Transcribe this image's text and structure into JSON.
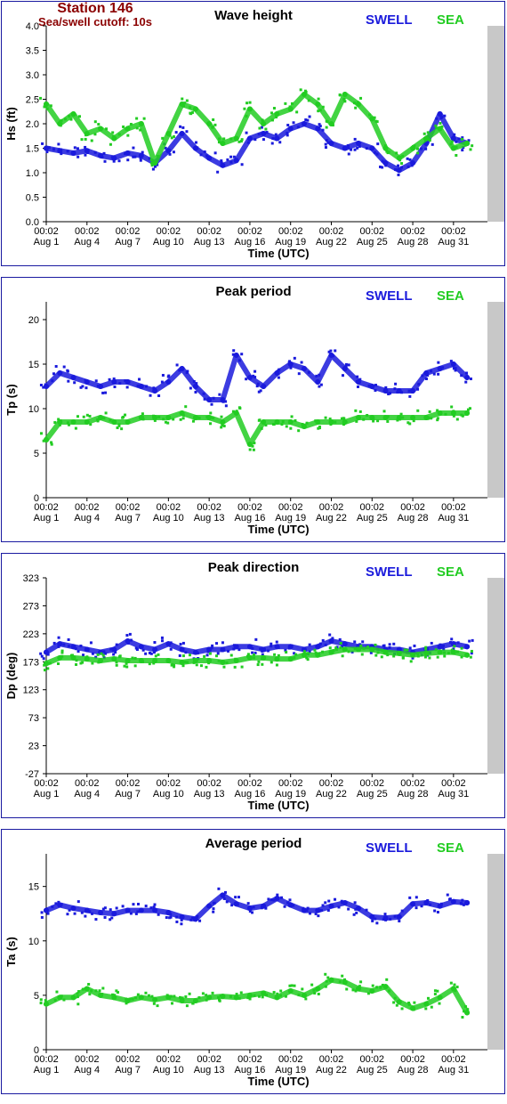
{
  "header": {
    "station": "Station 146",
    "cutoff": "Sea/swell cutoff: 10s"
  },
  "legend": {
    "swell": "SWELL",
    "sea": "SEA"
  },
  "colors": {
    "swell": "#1a1adc",
    "sea": "#22cc22",
    "plot_bg": "#c8c8c8",
    "plot_area": "#ffffff",
    "title": "#000000",
    "station": "#8b0000"
  },
  "xaxis": {
    "label": "Time (UTC)",
    "ticks": [
      {
        "time": "00:02",
        "date": "Aug 1"
      },
      {
        "time": "00:02",
        "date": "Aug 4"
      },
      {
        "time": "00:02",
        "date": "Aug 7"
      },
      {
        "time": "00:02",
        "date": "Aug 10"
      },
      {
        "time": "00:02",
        "date": "Aug 13"
      },
      {
        "time": "00:02",
        "date": "Aug 16"
      },
      {
        "time": "00:02",
        "date": "Aug 19"
      },
      {
        "time": "00:02",
        "date": "Aug 22"
      },
      {
        "time": "00:02",
        "date": "Aug 25"
      },
      {
        "time": "00:02",
        "date": "Aug 28"
      },
      {
        "time": "00:02",
        "date": "Aug 31"
      }
    ]
  },
  "chart_data": [
    {
      "type": "scatter",
      "title": "Wave height",
      "ylabel": "Hs (ft)",
      "ylim": [
        0,
        4
      ],
      "yticks": [
        "0.0",
        "0.5",
        "1.0",
        "1.5",
        "2.0",
        "2.5",
        "3.0",
        "3.5",
        "4.0"
      ],
      "x": [
        1,
        2,
        3,
        4,
        5,
        6,
        7,
        8,
        9,
        10,
        11,
        12,
        13,
        14,
        15,
        16,
        17,
        18,
        19,
        20,
        21,
        22,
        23,
        24,
        25,
        26,
        27,
        28,
        29,
        30,
        31,
        32
      ],
      "series": [
        {
          "name": "SWELL",
          "values": [
            1.5,
            1.45,
            1.4,
            1.45,
            1.35,
            1.3,
            1.4,
            1.35,
            1.2,
            1.45,
            1.8,
            1.5,
            1.3,
            1.15,
            1.25,
            1.7,
            1.8,
            1.7,
            1.9,
            2.0,
            1.9,
            1.6,
            1.5,
            1.6,
            1.5,
            1.2,
            1.05,
            1.2,
            1.6,
            2.2,
            1.7,
            1.6
          ]
        },
        {
          "name": "SEA",
          "values": [
            2.4,
            2.0,
            2.2,
            1.8,
            1.9,
            1.7,
            1.9,
            2.0,
            1.2,
            1.8,
            2.4,
            2.3,
            2.0,
            1.6,
            1.7,
            2.3,
            2.0,
            2.2,
            2.3,
            2.6,
            2.4,
            2.0,
            2.6,
            2.4,
            2.1,
            1.5,
            1.3,
            1.5,
            1.7,
            1.9,
            1.5,
            1.6
          ]
        }
      ]
    },
    {
      "type": "scatter",
      "title": "Peak period",
      "ylabel": "Tp (s)",
      "ylim": [
        0,
        22
      ],
      "yticks": [
        "0",
        "5",
        "10",
        "15",
        "20"
      ],
      "x": [
        1,
        2,
        3,
        4,
        5,
        6,
        7,
        8,
        9,
        10,
        11,
        12,
        13,
        14,
        15,
        16,
        17,
        18,
        19,
        20,
        21,
        22,
        23,
        24,
        25,
        26,
        27,
        28,
        29,
        30,
        31,
        32
      ],
      "series": [
        {
          "name": "SWELL",
          "values": [
            12.5,
            14,
            13.5,
            13,
            12.5,
            13,
            13,
            12.5,
            12,
            13,
            14.5,
            12.5,
            11,
            11,
            16,
            13.5,
            12.5,
            14,
            15,
            14.5,
            13,
            16,
            14.5,
            13,
            12.5,
            12,
            12,
            12,
            14,
            14.5,
            15,
            13.5
          ]
        },
        {
          "name": "SEA",
          "values": [
            6.5,
            8.5,
            8.5,
            8.5,
            9,
            8.5,
            8.5,
            9,
            9,
            9,
            9.5,
            9,
            9,
            8.5,
            9.5,
            6,
            8.5,
            8.5,
            8.5,
            8,
            8.5,
            8.5,
            8.5,
            9,
            9,
            9,
            9,
            9,
            9,
            9.5,
            9.5,
            9.5
          ]
        }
      ]
    },
    {
      "type": "scatter",
      "title": "Peak direction",
      "ylabel": "Dp (deg)",
      "ylim": [
        -27,
        323
      ],
      "yticks": [
        "-27",
        "23",
        "73",
        "123",
        "173",
        "223",
        "273",
        "323"
      ],
      "x": [
        1,
        2,
        3,
        4,
        5,
        6,
        7,
        8,
        9,
        10,
        11,
        12,
        13,
        14,
        15,
        16,
        17,
        18,
        19,
        20,
        21,
        22,
        23,
        24,
        25,
        26,
        27,
        28,
        29,
        30,
        31,
        32
      ],
      "series": [
        {
          "name": "SWELL",
          "values": [
            190,
            205,
            200,
            195,
            190,
            195,
            210,
            200,
            195,
            205,
            195,
            190,
            195,
            195,
            200,
            200,
            195,
            200,
            200,
            195,
            200,
            210,
            205,
            200,
            200,
            195,
            195,
            190,
            195,
            200,
            205,
            200
          ]
        },
        {
          "name": "SEA",
          "values": [
            170,
            180,
            180,
            178,
            175,
            178,
            175,
            175,
            175,
            175,
            172,
            175,
            175,
            172,
            175,
            180,
            180,
            178,
            178,
            185,
            185,
            190,
            195,
            195,
            195,
            190,
            188,
            185,
            188,
            190,
            190,
            185
          ]
        }
      ]
    },
    {
      "type": "scatter",
      "title": "Average period",
      "ylabel": "Ta (s)",
      "ylim": [
        0,
        18
      ],
      "yticks": [
        "0",
        "5",
        "10",
        "15"
      ],
      "x": [
        1,
        2,
        3,
        4,
        5,
        6,
        7,
        8,
        9,
        10,
        11,
        12,
        13,
        14,
        15,
        16,
        17,
        18,
        19,
        20,
        21,
        22,
        23,
        24,
        25,
        26,
        27,
        28,
        29,
        30,
        31,
        32
      ],
      "series": [
        {
          "name": "SWELL",
          "values": [
            12.8,
            13.3,
            13.0,
            12.8,
            12.6,
            12.5,
            12.8,
            12.8,
            12.8,
            12.6,
            12.2,
            12.0,
            13.2,
            14.2,
            13.4,
            13.0,
            13.2,
            13.9,
            13.3,
            12.8,
            12.8,
            13.2,
            13.5,
            13.0,
            12.2,
            12.1,
            12.2,
            13.4,
            13.5,
            13.2,
            13.6,
            13.5
          ]
        },
        {
          "name": "SEA",
          "values": [
            4.2,
            4.8,
            4.8,
            5.6,
            5.0,
            4.8,
            4.5,
            4.8,
            4.6,
            4.8,
            4.5,
            4.5,
            4.8,
            4.9,
            4.8,
            5.0,
            5.2,
            4.8,
            5.4,
            5.0,
            5.6,
            6.4,
            6.2,
            5.6,
            5.4,
            5.8,
            4.4,
            3.8,
            4.2,
            4.8,
            5.6,
            3.4
          ]
        }
      ]
    }
  ]
}
